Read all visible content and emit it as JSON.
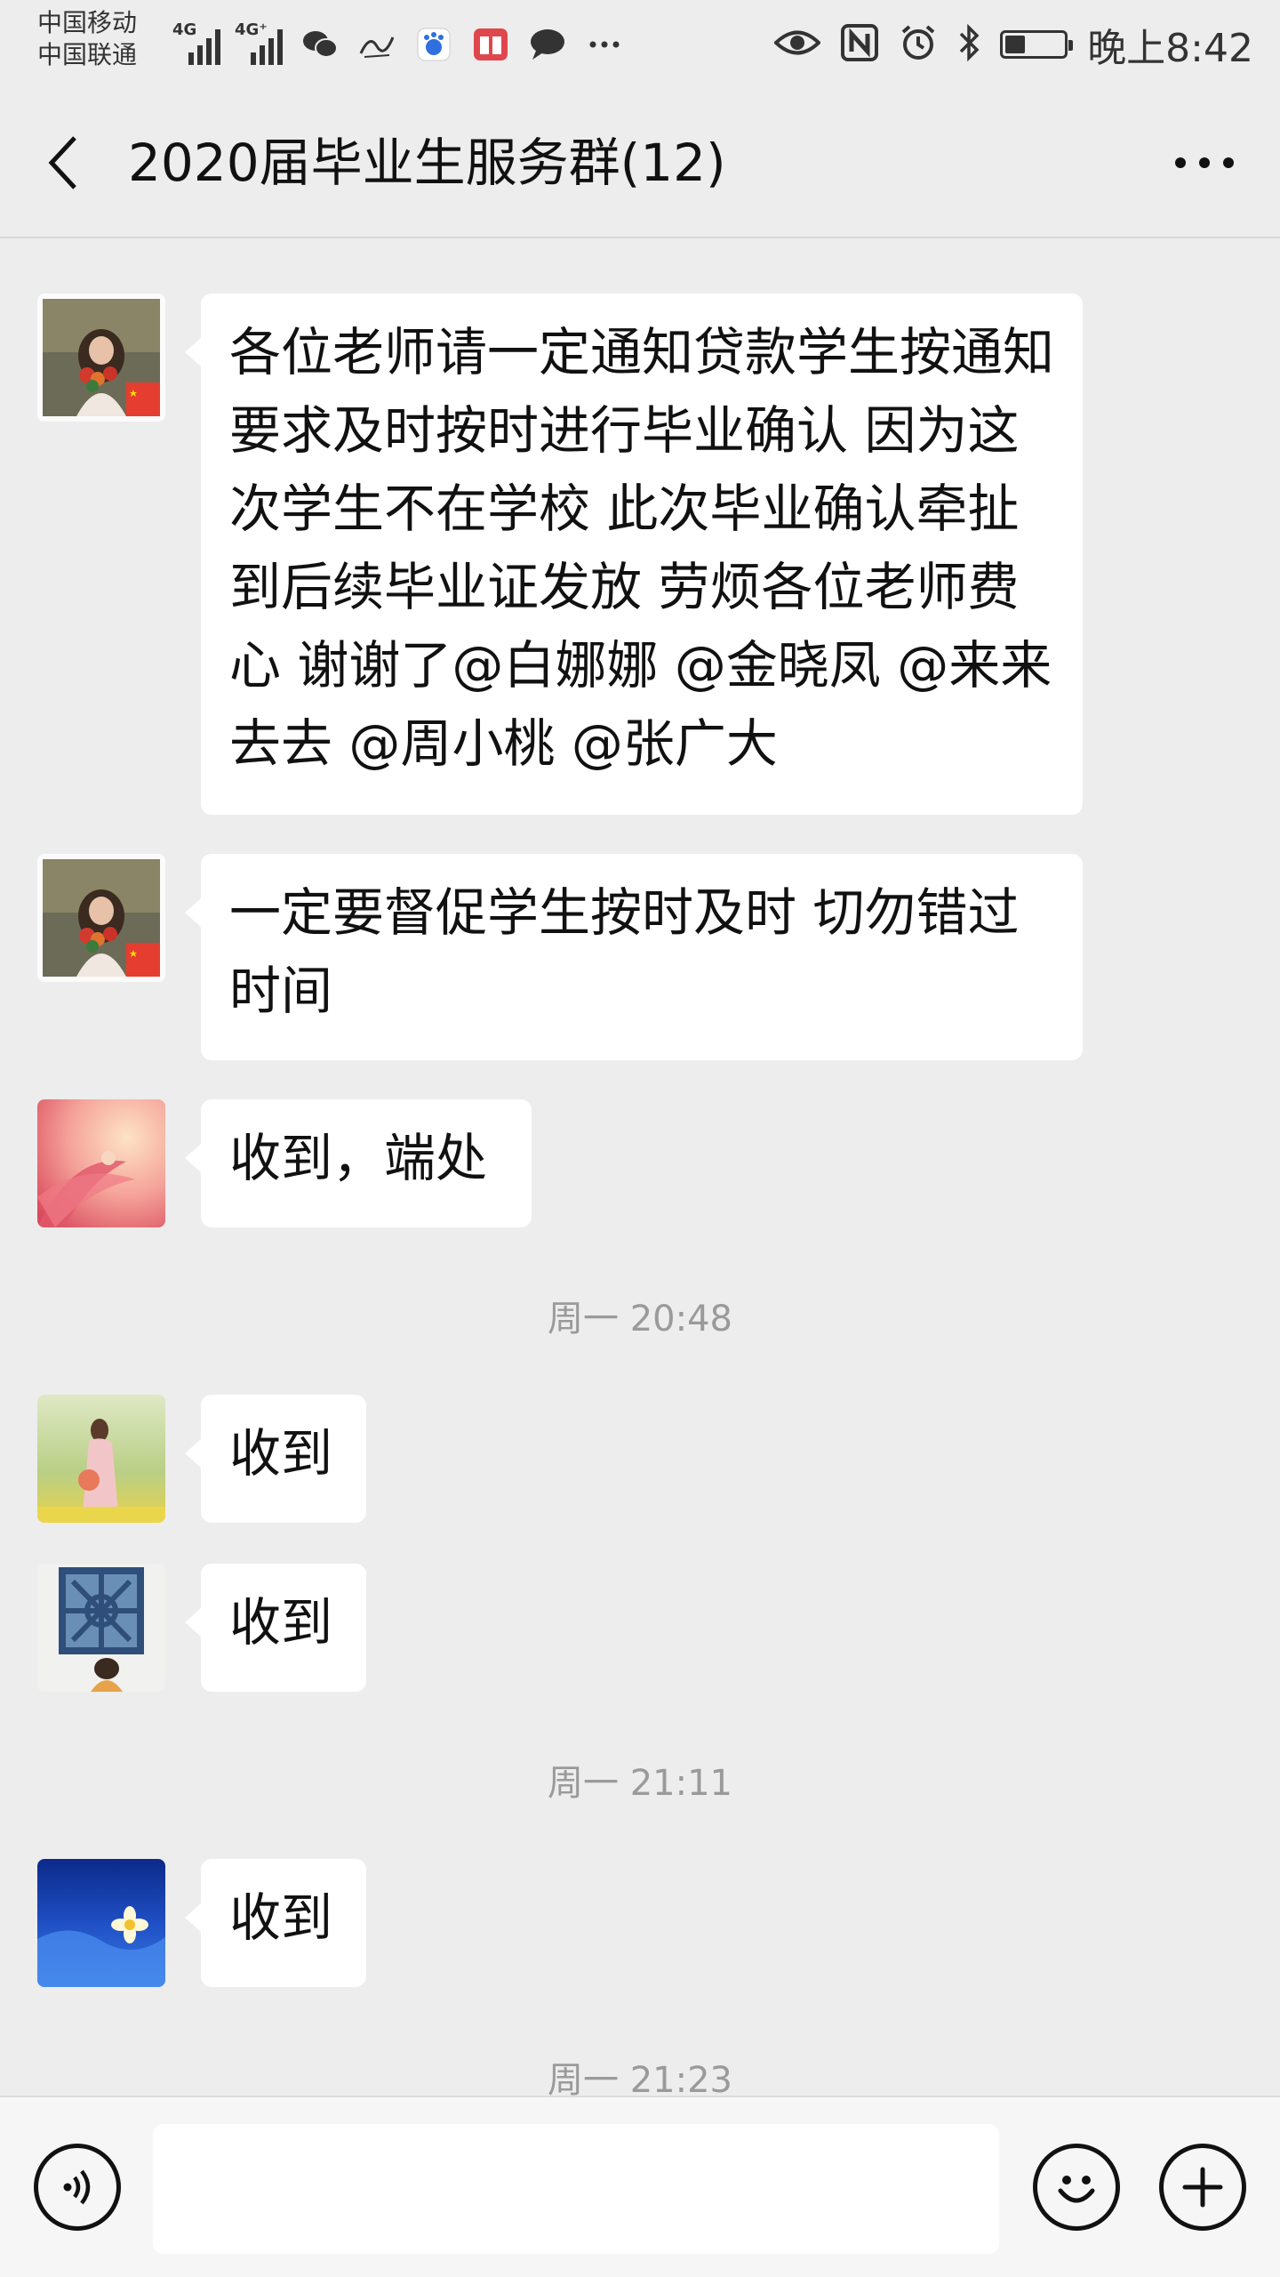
{
  "status_bar": {
    "carrier_1": "中国移动",
    "carrier_2": "中国联通",
    "signal_1_tag": "4G",
    "signal_2_tag": "4G⁺",
    "time": "晚上8:42",
    "battery_level": 0.35
  },
  "header": {
    "title": "2020届毕业生服务群(12)"
  },
  "messages": [
    {
      "text": "各位老师请一定通知贷款学生按通知要求及时按时进行毕业确认 因为这次学生不在学校 此次毕业确认牵扯到后续毕业证发放 劳烦各位老师费心 谢谢了@白娜娜 @金晓凤 @来来去去 @周小桃 @张广大",
      "avatar": "avatar-woman-flowers-flag"
    },
    {
      "text": "一定要督促学生按时及时 切勿错过时间",
      "avatar": "avatar-woman-flowers-flag"
    },
    {
      "text": "收到，端处",
      "avatar": "avatar-pink-flower"
    },
    {
      "text": "收到",
      "avatar": "avatar-girl-field"
    },
    {
      "text": "收到",
      "avatar": "avatar-window-lattice"
    },
    {
      "text": "收到",
      "avatar": "avatar-blue-water-flower"
    }
  ],
  "timestamps": [
    "周一 20:48",
    "周一 21:11",
    "周一 21:23"
  ],
  "input": {
    "value": "",
    "placeholder": ""
  },
  "icons": {
    "back": "chevron-left-icon",
    "more": "more-dots-icon",
    "voice": "voice-icon",
    "emoji": "emoji-icon",
    "plus": "plus-icon"
  },
  "colors": {
    "background": "#ededed",
    "bubble": "#ffffff",
    "timestamp": "#9a9a9a"
  }
}
